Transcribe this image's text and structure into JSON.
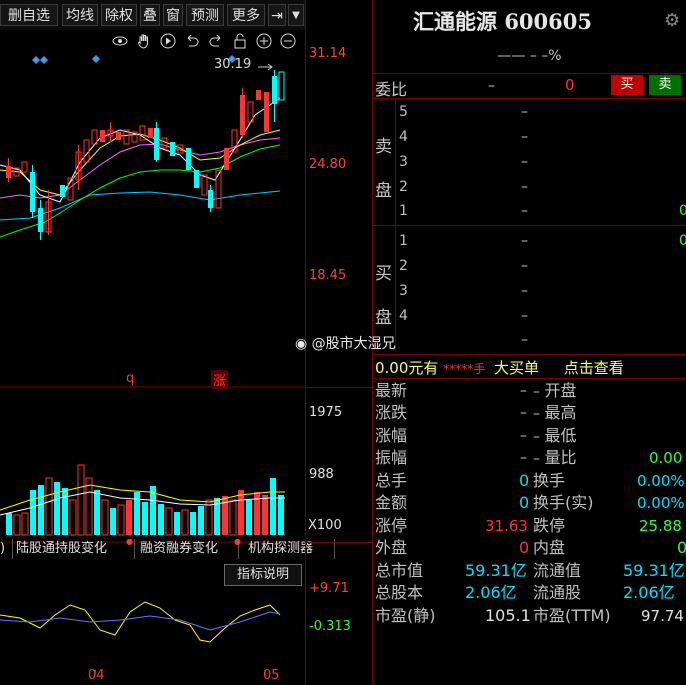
{
  "toolbar": {
    "items": [
      "删自选",
      "均线",
      "除权",
      "叠",
      "窗",
      "预测",
      "更多"
    ]
  },
  "chart": {
    "price_max": "31.14",
    "price_mid": "24.80",
    "price_min": "18.45",
    "high_label": "30.19",
    "vol_top": "1975",
    "vol_mid": "988",
    "vol_unit": "X100",
    "ind_top": "+9.71",
    "ind_bot": "-0.313",
    "marker_q": "q",
    "marker_zhang": "涨",
    "date_04": "04",
    "date_05": "05",
    "tabs": [
      ")",
      "陆股通持股变化",
      "融资融券变化",
      "机构探测器"
    ],
    "indicator_btn": "指标说明"
  },
  "quote": {
    "name": "汇通能源",
    "code": "600605",
    "sub_line": "—— – –%",
    "weibi_label": "委比",
    "weibi_val1": "–",
    "weibi_val2": "0",
    "buy_btn": "买",
    "sell_btn": "卖",
    "sell_label": "卖盘",
    "buy_label": "买盘",
    "dash": "–",
    "sell_levels": [
      "5",
      "4",
      "3",
      "2",
      "1"
    ],
    "buy_levels": [
      "1",
      "2",
      "3",
      "4"
    ],
    "zero": "0",
    "big_order": {
      "amount": "0.00元有",
      "stars": "*****手",
      "text": "大买单",
      "link": "点击查看"
    },
    "watermark": "@股市大湿兄",
    "stats_left": [
      {
        "label": "最新",
        "value": "–"
      },
      {
        "label": "涨跌",
        "value": "–"
      },
      {
        "label": "涨幅",
        "value": "–"
      },
      {
        "label": "振幅",
        "value": "–"
      },
      {
        "label": "总手",
        "value": "0"
      },
      {
        "label": "金额",
        "value": "0"
      },
      {
        "label": "涨停",
        "value": "31.63"
      },
      {
        "label": "外盘",
        "value": "0"
      },
      {
        "label": "总市值",
        "value": "59.31亿"
      },
      {
        "label": "总股本",
        "value": "2.06亿"
      },
      {
        "label": "市盈(静)",
        "value": "105.1"
      }
    ],
    "stats_right": [
      {
        "label": "开盘",
        "value": ""
      },
      {
        "label": "最高",
        "value": ""
      },
      {
        "label": "最低",
        "value": ""
      },
      {
        "label": "量比",
        "value": "0.00"
      },
      {
        "label": "换手",
        "value": "0.00%"
      },
      {
        "label": "换手(实)",
        "value": "0.00%"
      },
      {
        "label": "跌停",
        "value": "25.88"
      },
      {
        "label": "内盘",
        "value": "0"
      },
      {
        "label": "流通值",
        "value": "59.31亿"
      },
      {
        "label": "流通股",
        "value": "2.06亿"
      },
      {
        "label": "市盈(TTM)",
        "value": "97.74"
      }
    ]
  },
  "colors": {
    "up": "#ff3333",
    "down": "#00ffff",
    "ma5": "#ffffff",
    "ma10": "#ffff00",
    "ma20": "#ff66ff",
    "ma30": "#00ff00",
    "ma60": "#00ccff"
  }
}
